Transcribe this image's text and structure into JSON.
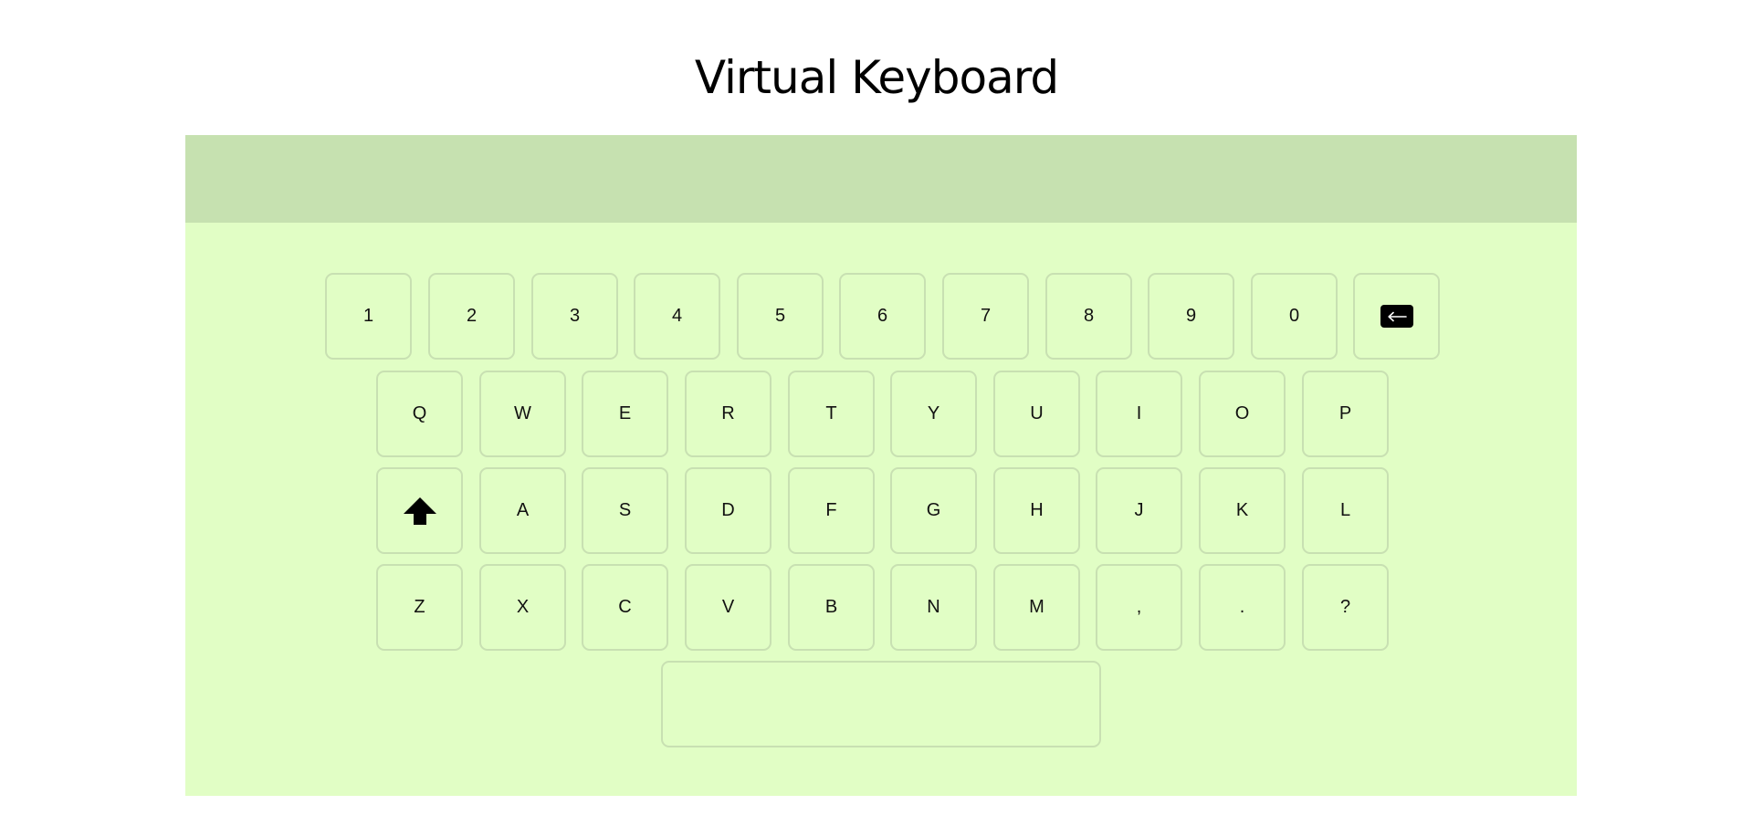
{
  "page": {
    "title": "Virtual Keyboard"
  },
  "display": {
    "value": ""
  },
  "colors": {
    "panel_background": "#e1fec5",
    "display_background": "#c6e1b0",
    "key_border": "#c8e0b2"
  },
  "keyboard": {
    "rows": [
      [
        "1",
        "2",
        "3",
        "4",
        "5",
        "6",
        "7",
        "8",
        "9",
        "0"
      ],
      [
        "Q",
        "W",
        "E",
        "R",
        "T",
        "Y",
        "U",
        "I",
        "O",
        "P"
      ],
      [
        "A",
        "S",
        "D",
        "F",
        "G",
        "H",
        "J",
        "K",
        "L"
      ],
      [
        "Z",
        "X",
        "C",
        "V",
        "B",
        "N",
        "M",
        ",",
        ".",
        "?"
      ]
    ],
    "icons": {
      "backspace": "backspace-arrow-icon",
      "shift": "shift-arrow-up-icon"
    }
  }
}
